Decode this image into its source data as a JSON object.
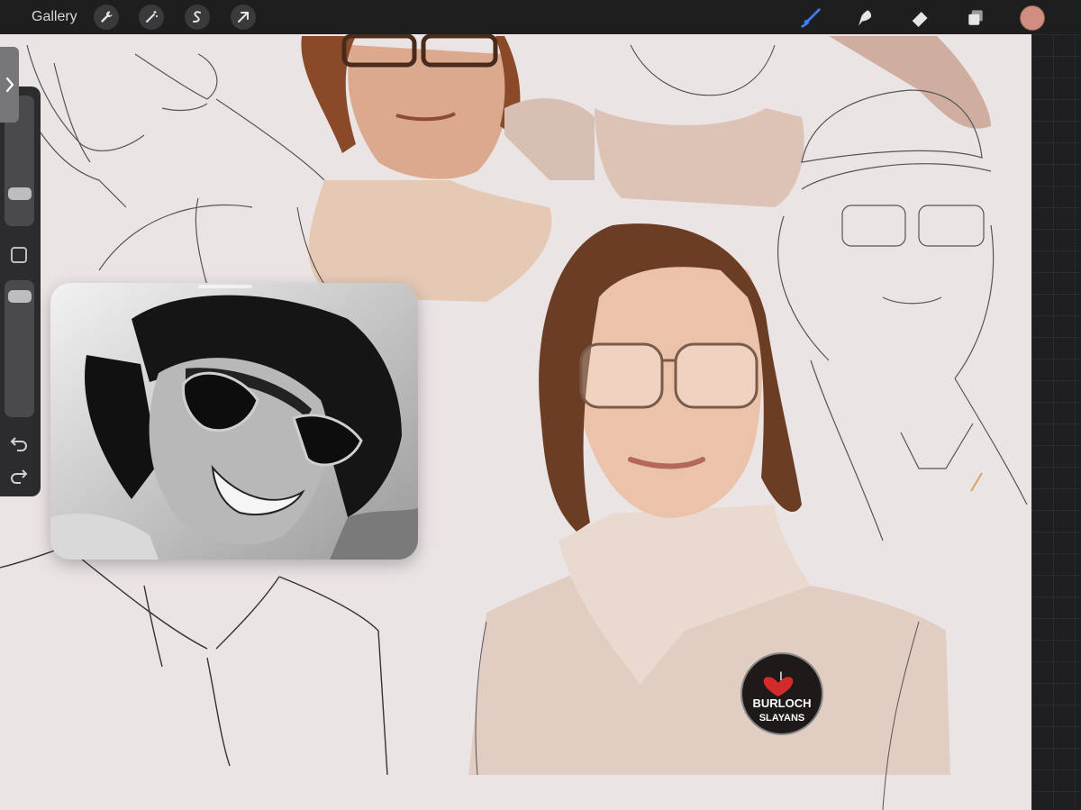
{
  "toolbar": {
    "gallery_label": "Gallery",
    "left_tools": [
      "wrench-icon",
      "magic-wand-icon",
      "selection-icon",
      "transform-arrow-icon"
    ],
    "right_tools": [
      "brush-icon",
      "smudge-icon",
      "eraser-icon",
      "layers-icon"
    ],
    "active_tool": "brush-icon",
    "current_color": "#d18e80",
    "accent_color": "#3d7cf2"
  },
  "sidebar": {
    "brush_size": 0.2,
    "opacity": 0.05,
    "tools": [
      "modify-button",
      "undo-icon",
      "redo-icon"
    ]
  },
  "canvas": {
    "badge_text_1": "I",
    "badge_text_2": "BURLOCH",
    "badge_text_3": "SLAYANS"
  },
  "reference_window": {
    "content": "reference photo"
  }
}
